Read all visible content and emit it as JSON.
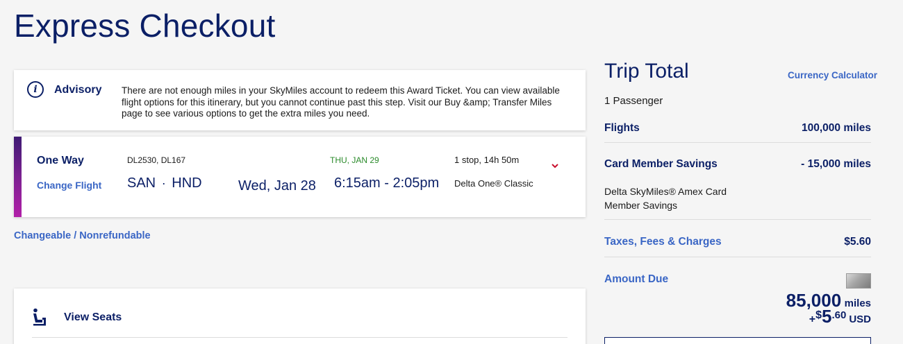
{
  "page_title": "Express Checkout",
  "advisory": {
    "title": "Advisory",
    "message": "There are not enough miles in your SkyMiles account to redeem this Award Ticket. You can view available flight options for this itinerary, but you cannot continue past this step. Visit our Buy &amp; Transfer Miles page to see various options to get the extra miles you need."
  },
  "flight": {
    "trip_type": "One Way",
    "change_label": "Change Flight",
    "flight_numbers": "DL2530, DL167",
    "origin": "SAN",
    "separator": "·",
    "destination": "HND",
    "departure_date": "Wed, Jan 28",
    "arrival_date": "THU, JAN 29",
    "times": "6:15am - 2:05pm",
    "stops": "1 stop, 14h 50m",
    "cabin": "Delta One® Classic",
    "accent_colors": [
      "#3e1a73",
      "#b11fa8"
    ]
  },
  "fare_rules": "Changeable / Nonrefundable",
  "seats": {
    "label": "View Seats"
  },
  "trip_total": {
    "title": "Trip Total",
    "currency_link": "Currency Calculator",
    "passengers": "1 Passenger",
    "flights_label": "Flights",
    "flights_value": "100,000 miles",
    "savings_label": "Card Member Savings",
    "savings_value": "- 15,000 miles",
    "savings_description": "Delta SkyMiles® Amex Card Member Savings",
    "taxes_label": "Taxes, Fees & Charges",
    "taxes_value": "$5.60",
    "amount_due_label": "Amount Due",
    "due_miles": "85,000",
    "due_miles_unit": "miles",
    "due_plus": "+",
    "due_dollar": "$",
    "due_whole": "5",
    "due_cents": ".60",
    "due_currency": "USD"
  },
  "colors": {
    "navy": "#0b1f66",
    "link_blue": "#3a66c5",
    "arrival_green": "#2a8a2a",
    "chevron_red": "#c8102e"
  }
}
